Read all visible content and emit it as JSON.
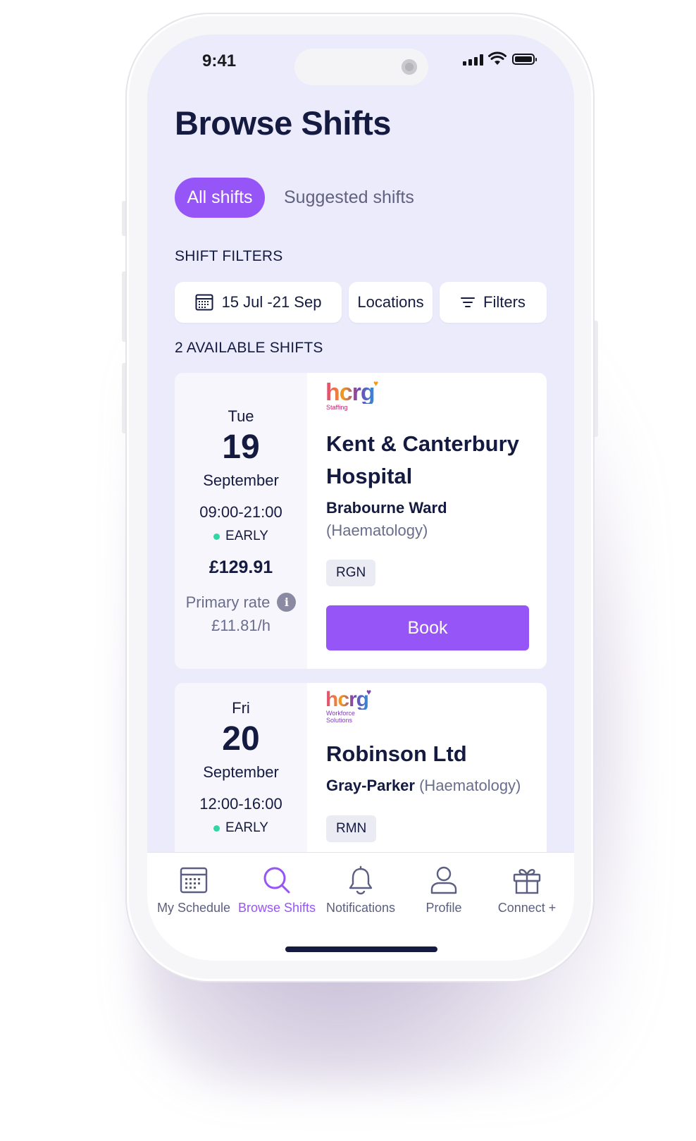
{
  "status_bar": {
    "time": "9:41"
  },
  "header": {
    "title": "Browse Shifts"
  },
  "tabs": [
    {
      "label": "All shifts",
      "active": true
    },
    {
      "label": "Suggested shifts",
      "active": false
    }
  ],
  "filters": {
    "section_label": "SHIFT FILTERS",
    "date_range": "15 Jul -21 Sep",
    "locations": "Locations",
    "filters": "Filters"
  },
  "results": {
    "count_label": "2 AVAILABLE SHIFTS"
  },
  "shifts": [
    {
      "day_of_week": "Tue",
      "day": "19",
      "month": "September",
      "time": "09:00-21:00",
      "shift_type": "EARLY",
      "price": "£129.91",
      "primary_rate_label": "Primary rate",
      "primary_rate": "£11.81/h",
      "logo": {
        "text": "hcrg",
        "sub": "Staffing"
      },
      "hospital_line1": "Kent & Canterbury",
      "hospital_line2": "Hospital",
      "ward": "Brabourne Ward",
      "department": "(Haematology)",
      "role": "RGN",
      "book_label": "Book"
    },
    {
      "day_of_week": "Fri",
      "day": "20",
      "month": "September",
      "time": "12:00-16:00",
      "shift_type": "EARLY",
      "logo": {
        "text": "hcrg",
        "sub_line1": "Workforce",
        "sub_line2": "Solutions"
      },
      "hospital_line1": "Robinson Ltd",
      "ward": "Gray-Parker",
      "department": "(Haematology)",
      "role": "RMN"
    }
  ],
  "nav": [
    {
      "label": "My Schedule",
      "icon": "calendar-icon",
      "active": false
    },
    {
      "label": "Browse Shifts",
      "icon": "search-icon",
      "active": true
    },
    {
      "label": "Notifications",
      "icon": "bell-icon",
      "active": false
    },
    {
      "label": "Profile",
      "icon": "person-icon",
      "active": false
    },
    {
      "label": "Connect +",
      "icon": "gift-icon",
      "active": false
    }
  ],
  "colors": {
    "accent": "#9655f7",
    "screen_bg": "#ebebfb",
    "text_primary": "#141a40",
    "text_secondary": "#6a6d8e",
    "early_dot": "#2ed8a4"
  }
}
